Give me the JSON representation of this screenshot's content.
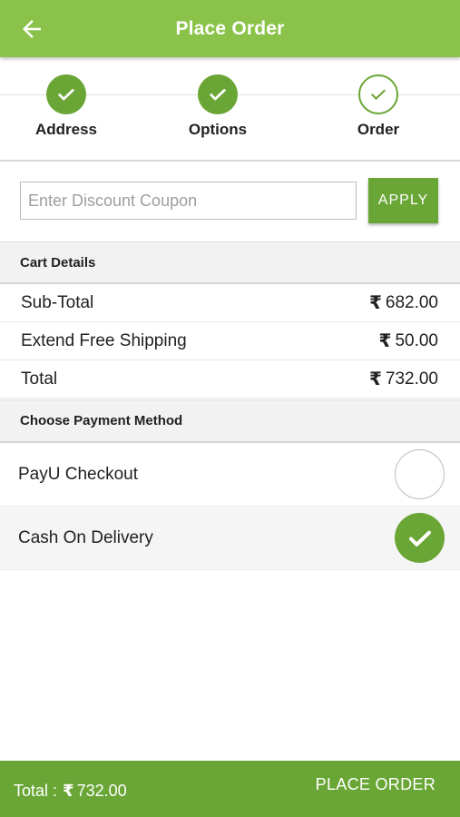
{
  "header": {
    "title": "Place Order",
    "back_icon": "arrow-left-icon"
  },
  "stepper": {
    "steps": [
      {
        "label": "Address",
        "state": "done"
      },
      {
        "label": "Options",
        "state": "done"
      },
      {
        "label": "Order",
        "state": "current"
      }
    ]
  },
  "coupon": {
    "placeholder": "Enter Discount Coupon",
    "value": "",
    "apply_label": "APPLY"
  },
  "cart": {
    "title": "Cart Details",
    "currency_symbol": "₹",
    "rows": [
      {
        "label": "Sub-Total",
        "amount": "682.00"
      },
      {
        "label": "Extend Free Shipping",
        "amount": "50.00"
      },
      {
        "label": "Total",
        "amount": "732.00"
      }
    ]
  },
  "payment": {
    "title": "Choose Payment Method",
    "methods": [
      {
        "label": "PayU Checkout",
        "selected": false
      },
      {
        "label": "Cash On Delivery",
        "selected": true
      }
    ]
  },
  "footer": {
    "total_label": "Total :",
    "currency_symbol": "₹",
    "total_amount": "732.00",
    "place_order_label": "PLACE ORDER"
  },
  "colors": {
    "primary": "#8bc34a",
    "accent": "#6aa636",
    "section_bg": "#f2f2f2"
  }
}
